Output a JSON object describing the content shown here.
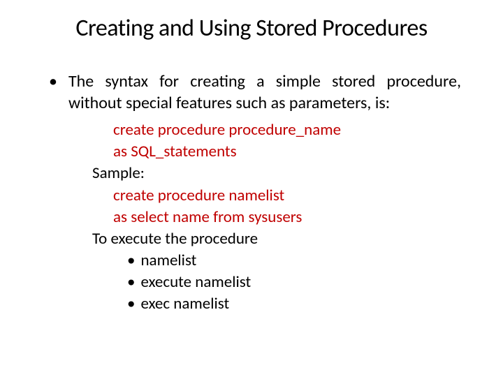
{
  "title": "Creating and Using Stored Procedures",
  "bullet": {
    "marker": "•",
    "text": "The syntax for creating a simple stored procedure, without special features such as parameters, is:"
  },
  "code": {
    "line1": "create procedure procedure_name",
    "line2": "as SQL_statements"
  },
  "sample_label": "Sample:",
  "sample": {
    "line1": "create procedure namelist",
    "line2": "as select name from sysusers"
  },
  "exec_label": "To execute the procedure",
  "exec_items": [
    {
      "marker": "•",
      "text": "namelist"
    },
    {
      "marker": "•",
      "text": "execute namelist"
    },
    {
      "marker": "•",
      "text": "exec namelist"
    }
  ]
}
